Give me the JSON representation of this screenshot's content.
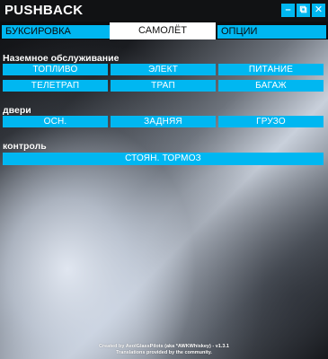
{
  "window": {
    "title": "PUSHBACK",
    "controls": {
      "minimize_icon": "–",
      "popout_icon": "⧉",
      "close_icon": "✕"
    }
  },
  "tabs": [
    {
      "label": "БУКСИРОВКА",
      "active": false
    },
    {
      "label": "САМОЛЁТ",
      "active": true
    },
    {
      "label": "ОПЦИИ",
      "active": false
    }
  ],
  "ground_service": {
    "heading": "Наземное обслуживание",
    "buttons": [
      "ТОПЛИВО",
      "ЭЛЕКТ",
      "ПИТАНИЕ",
      "ТЕЛЕТРАП",
      "ТРАП",
      "БАГАЖ"
    ]
  },
  "doors": {
    "heading": "двери",
    "buttons": [
      "ОСН.",
      "ЗАДНЯЯ",
      "ГРУЗО"
    ]
  },
  "control": {
    "heading": "контроль",
    "parking_brake": "СТОЯН. ТОРМОЗ"
  },
  "footer": {
    "line1": "Created by AeolGlassPilots (aka *AWKWhiskey) - v1.3.1",
    "line2": "Translations provided by the community."
  },
  "colors": {
    "accent": "#00b7f1",
    "titlebar": "#111214",
    "active_tab": "#ffffff"
  }
}
